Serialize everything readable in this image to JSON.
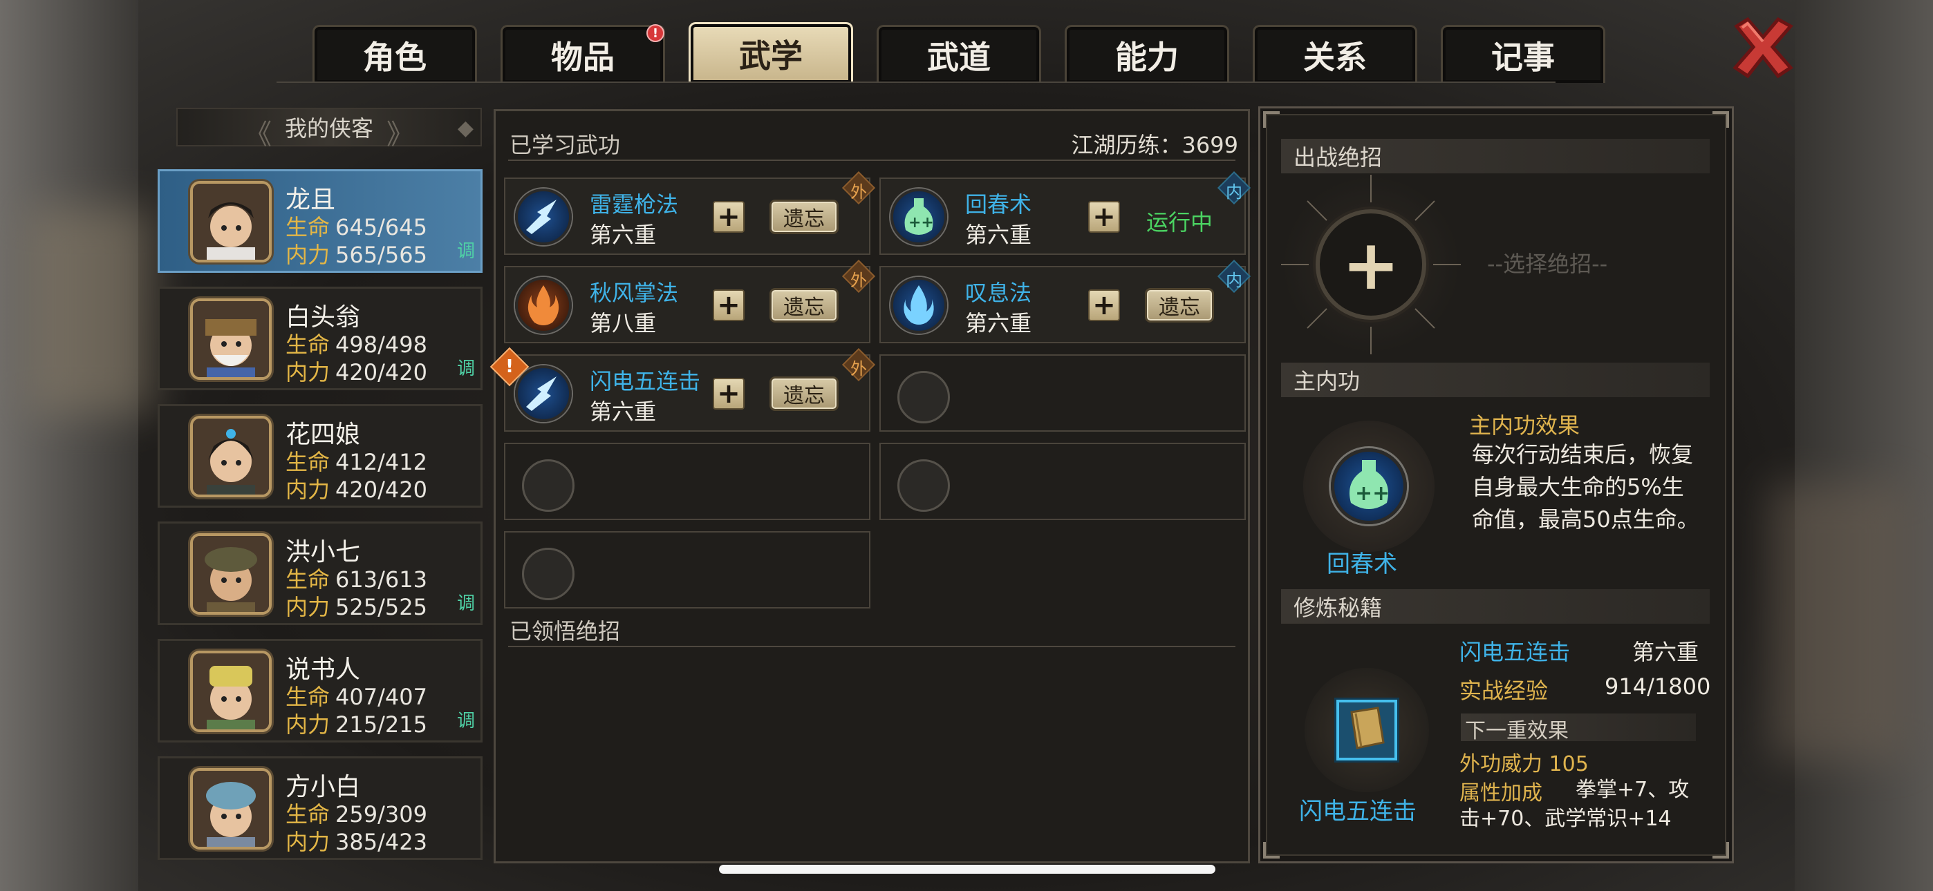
{
  "tabs": [
    {
      "label": "角色"
    },
    {
      "label": "物品",
      "badge": "!"
    },
    {
      "label": "武学",
      "active": true
    },
    {
      "label": "武道"
    },
    {
      "label": "能力"
    },
    {
      "label": "关系"
    },
    {
      "label": "记事"
    }
  ],
  "left": {
    "header": "我的侠客",
    "characters": [
      {
        "name": "龙且",
        "hp_label": "生命",
        "hp": "645/645",
        "mp_label": "内力",
        "mp": "565/565",
        "tag": "调"
      },
      {
        "name": "白头翁",
        "hp_label": "生命",
        "hp": "498/498",
        "mp_label": "内力",
        "mp": "420/420",
        "tag": "调"
      },
      {
        "name": "花四娘",
        "hp_label": "生命",
        "hp": "412/412",
        "mp_label": "内力",
        "mp": "420/420",
        "tag": ""
      },
      {
        "name": "洪小七",
        "hp_label": "生命",
        "hp": "613/613",
        "mp_label": "内力",
        "mp": "525/525",
        "tag": "调"
      },
      {
        "name": "说书人",
        "hp_label": "生命",
        "hp": "407/407",
        "mp_label": "内力",
        "mp": "215/215",
        "tag": "调"
      },
      {
        "name": "方小白",
        "hp_label": "生命",
        "hp": "259/309",
        "mp_label": "内力",
        "mp": "385/423",
        "tag": ""
      }
    ]
  },
  "middle": {
    "learned_title": "已学习武功",
    "experience": "江湖历练：3699",
    "skills": [
      {
        "name": "雷霆枪法",
        "level": "第六重",
        "type": "外",
        "action": "遗忘"
      },
      {
        "name": "回春术",
        "level": "第六重",
        "type": "内",
        "action": "运行中"
      },
      {
        "name": "秋风掌法",
        "level": "第八重",
        "type": "外",
        "action": "遗忘"
      },
      {
        "name": "叹息法",
        "level": "第六重",
        "type": "内",
        "action": "遗忘"
      },
      {
        "name": "闪电五连击",
        "level": "第六重",
        "type": "外",
        "action": "遗忘",
        "warn": "!"
      }
    ],
    "plus": "+",
    "ultimate_title": "已领悟绝招"
  },
  "right": {
    "battle_title": "出战绝招",
    "choose": "--选择绝招--",
    "add": "+",
    "inner_title": "主内功",
    "inner_name": "回春术",
    "effect_title": "主内功效果",
    "effect_text": "每次行动结束后，恢复自身最大生命的5%生命值，最高50点生命。",
    "cultivate_title": "修炼秘籍",
    "book_name": "闪电五连击",
    "book_level": "第六重",
    "exp_label": "实战经验",
    "exp_value": "914/1800",
    "next_label": "下一重效果",
    "power": "外功威力 105",
    "attr_label": "属性加成",
    "attr_text": "拳掌+7、攻击+70、武学常识+14",
    "book_caption": "闪电五连击"
  },
  "colors": {
    "accent": "#3fb3e8",
    "gold": "#e3b646",
    "green": "#4bd462",
    "teal": "#4fd1a6"
  }
}
